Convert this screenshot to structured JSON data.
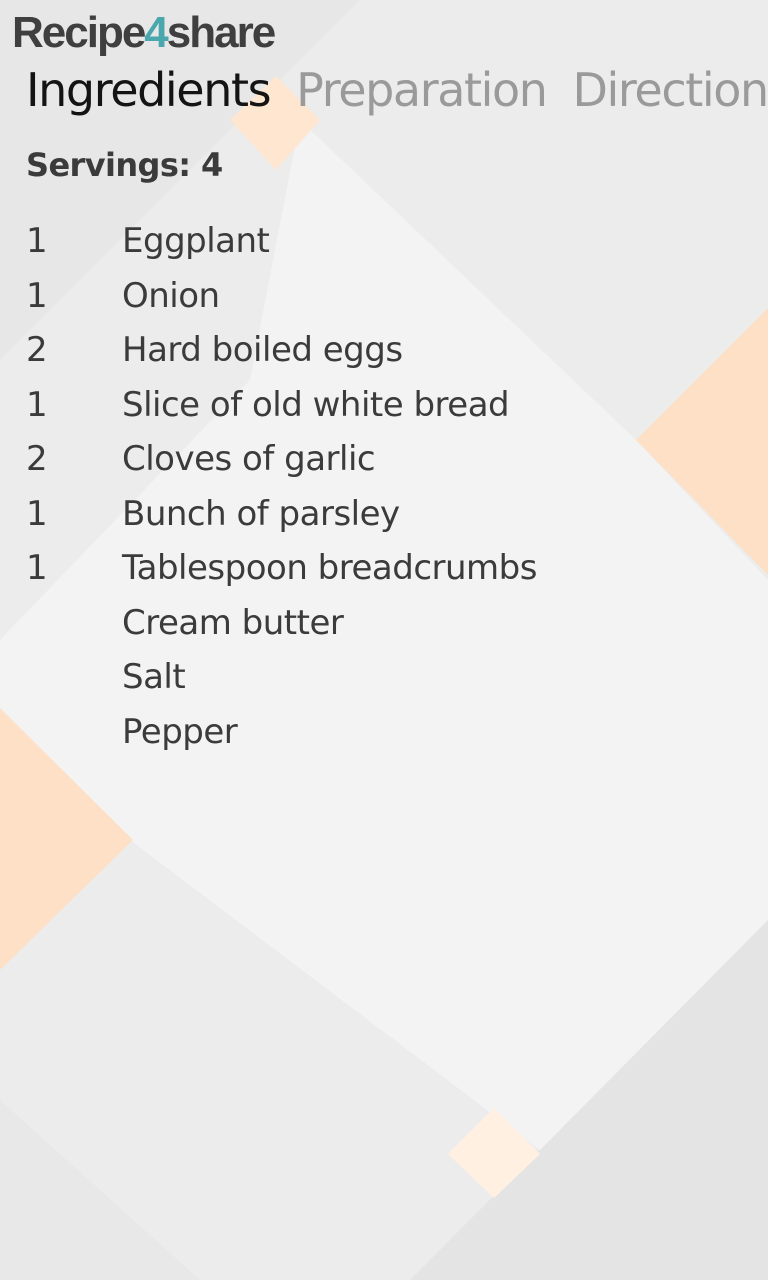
{
  "app": {
    "logo_prefix": "Recipe",
    "logo_accent": "4",
    "logo_suffix": "share",
    "accent_color": "#4aa7ad"
  },
  "tabs": [
    {
      "label": "Ingredients",
      "active": true
    },
    {
      "label": "Preparation",
      "active": false
    },
    {
      "label": "Directions",
      "active": false
    }
  ],
  "servings_label": "Servings: 4",
  "ingredients": [
    {
      "qty": "1",
      "name": "Eggplant"
    },
    {
      "qty": "1",
      "name": "Onion"
    },
    {
      "qty": "2",
      "name": "Hard boiled eggs"
    },
    {
      "qty": "1",
      "name": "Slice of old white bread"
    },
    {
      "qty": "2",
      "name": "Cloves of garlic"
    },
    {
      "qty": "1",
      "name": "Bunch of parsley"
    },
    {
      "qty": "1",
      "name": "Tablespoon breadcrumbs"
    },
    {
      "qty": "",
      "name": "Cream butter"
    },
    {
      "qty": "",
      "name": "Salt"
    },
    {
      "qty": "",
      "name": "Pepper"
    }
  ],
  "colors": {
    "background": "#ececec",
    "panel": "#f3f3f3",
    "peach": "#fee0c6",
    "tab_active": "#141414",
    "tab_inactive": "#9a9a9a",
    "text": "#3b3b3b"
  }
}
